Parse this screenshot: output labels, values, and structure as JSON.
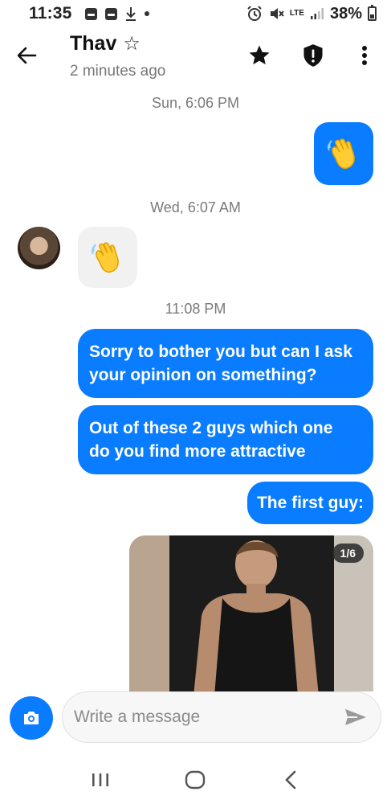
{
  "status_bar": {
    "time": "11:35",
    "network": "LTE",
    "battery": "38%"
  },
  "header": {
    "contact_name": "Thav",
    "last_seen": "2 minutes ago",
    "icons": [
      "back-arrow-icon",
      "star-outline-icon",
      "star-filled-icon",
      "shield-alert-icon",
      "more-vertical-icon"
    ]
  },
  "messages": [
    {
      "type": "timestamp",
      "text": "Sun, 6:06 PM"
    },
    {
      "type": "emoji",
      "direction": "outgoing",
      "emoji": "👋"
    },
    {
      "type": "timestamp",
      "text": "Wed, 6:07 AM"
    },
    {
      "type": "emoji",
      "direction": "incoming",
      "emoji": "👋"
    },
    {
      "type": "timestamp",
      "text": "11:08 PM"
    },
    {
      "type": "text",
      "direction": "outgoing",
      "lines": [
        "Sorry to bother you but can I ask",
        "your opinion on something?"
      ]
    },
    {
      "type": "text",
      "direction": "outgoing",
      "lines": [
        "Out of these 2 guys which one",
        "do you find more attractive"
      ]
    },
    {
      "type": "text",
      "direction": "outgoing",
      "lines": [
        "The first guy:"
      ]
    },
    {
      "type": "photo",
      "direction": "outgoing",
      "counter": "1/6"
    }
  ],
  "composer": {
    "placeholder": "Write a message"
  },
  "colors": {
    "accent": "#0a7cff",
    "incoming_bubble": "#f1f1f1"
  }
}
